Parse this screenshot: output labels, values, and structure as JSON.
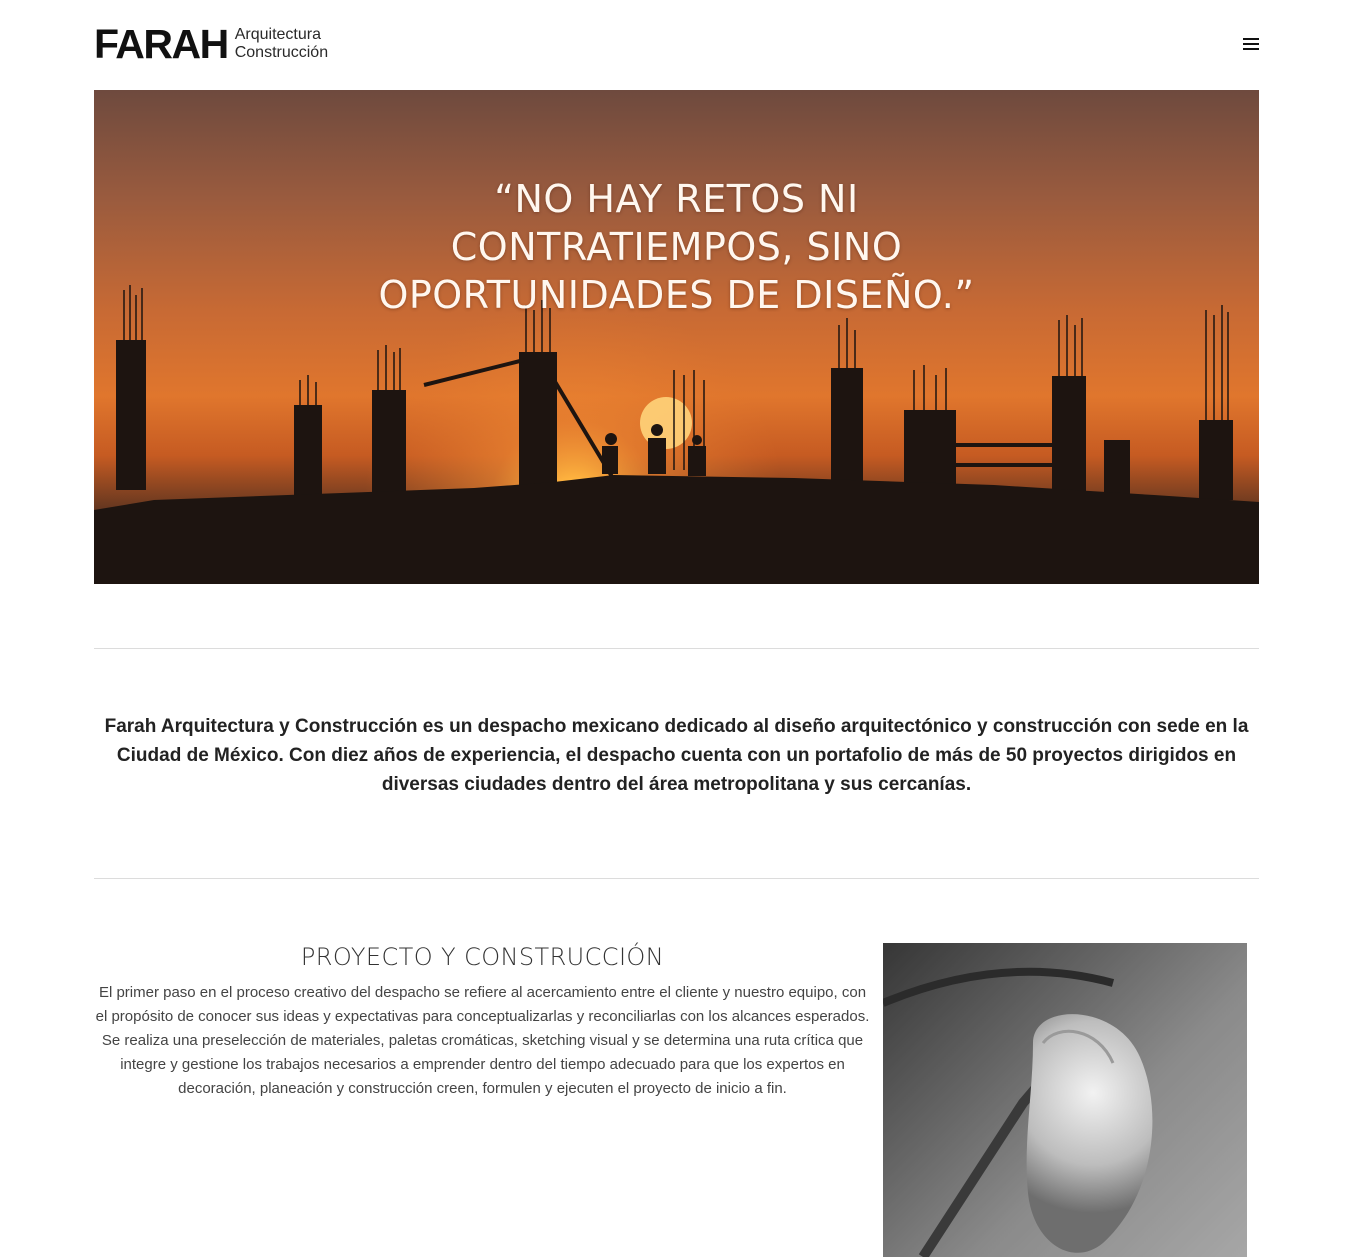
{
  "header": {
    "logo_mark": "FARAH",
    "logo_line1": "Arquitectura",
    "logo_line2": "Construcción"
  },
  "hero": {
    "quote_line1": "“NO HAY RETOS NI",
    "quote_line2": "CONTRATIEMPOS, SINO",
    "quote_line3": "OPORTUNIDADES DE DISEÑO.”"
  },
  "intro": {
    "text": "Farah Arquitectura y Construcción es un despacho mexicano dedicado al diseño arquitectónico y construcción con sede en la Ciudad de México. Con diez años de experiencia, el despacho cuenta con un portafolio de más de 50 proyectos dirigidos en diversas ciudades dentro del área metropolitana y sus cercanías."
  },
  "service": {
    "title": "PROYECTO Y CONSTRUCCIÓN",
    "text": "El primer paso en el proceso creativo del despacho se refiere al acercamiento entre el cliente y nuestro equipo, con el propósito de conocer sus ideas y expectativas para conceptualizarlas y reconciliarlas con los alcances esperados. Se realiza una preselección de materiales, paletas cromáticas, sketching visual y se determina una ruta crítica que integre y gestione los trabajos necesarios a emprender dentro del tiempo adecuado para que los expertos en decoración, planeación y construcción creen, formulen y ejecuten el proyecto de inicio a fin."
  },
  "icons": {
    "menu": "hamburger-menu-icon"
  }
}
